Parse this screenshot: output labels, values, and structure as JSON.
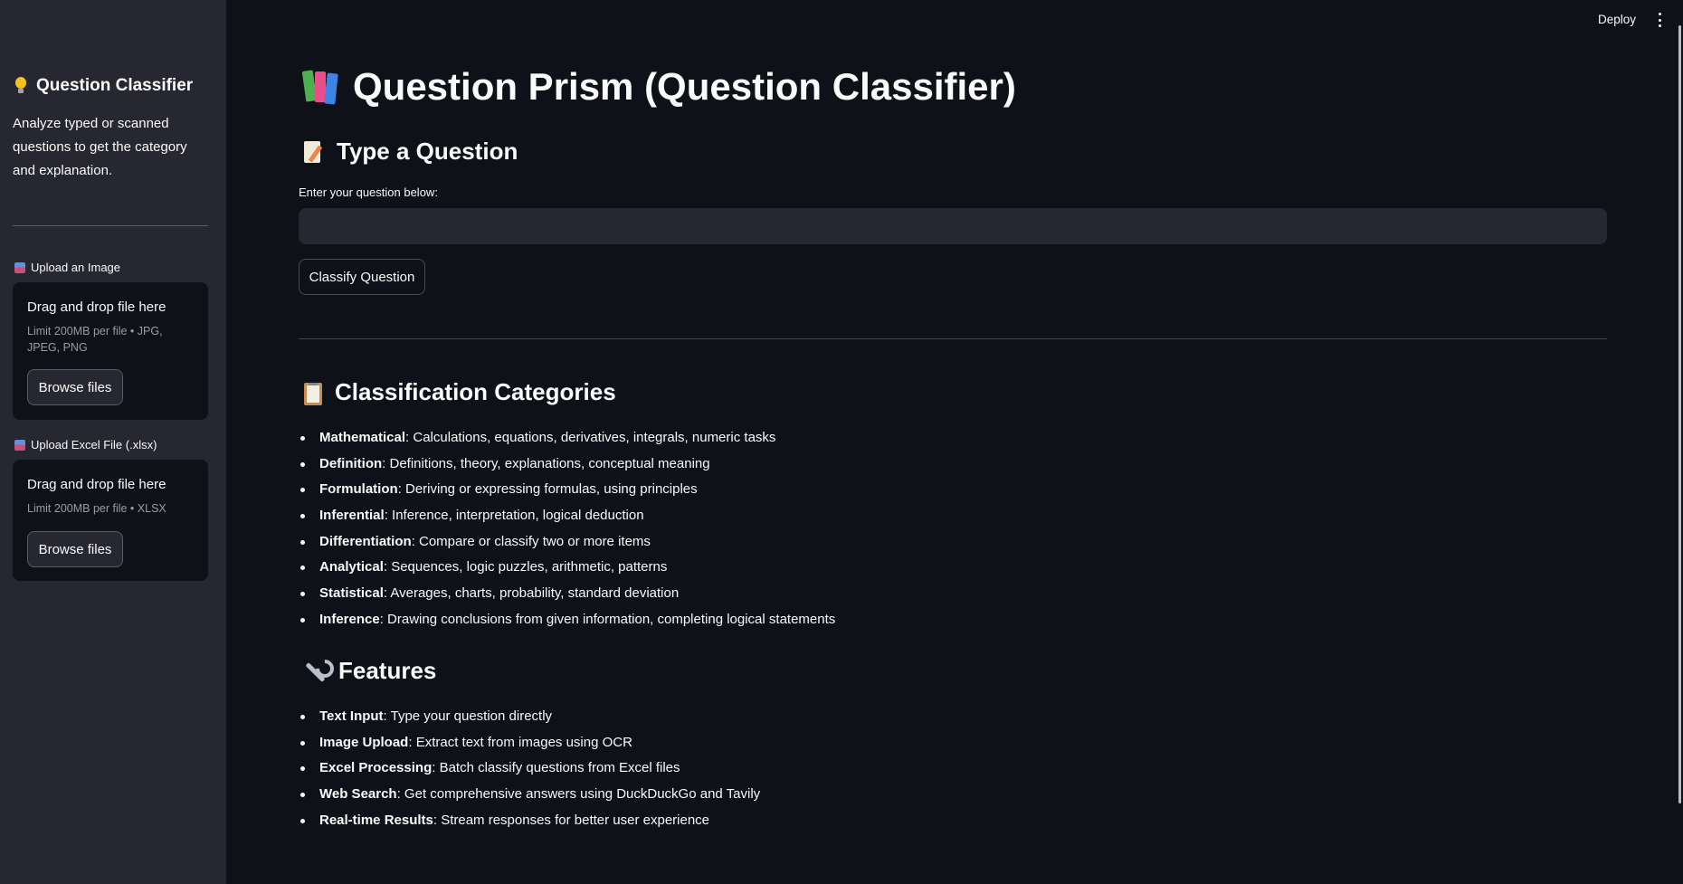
{
  "sidebar": {
    "title": "Question Classifier",
    "description": "Analyze typed or scanned questions to get the category and explanation.",
    "uploaders": [
      {
        "label": "Upload an Image",
        "drop_text": "Drag and drop file here",
        "limit": "Limit 200MB per file • JPG, JPEG, PNG",
        "button": "Browse files"
      },
      {
        "label": "Upload Excel File (.xlsx)",
        "drop_text": "Drag and drop file here",
        "limit": "Limit 200MB per file • XLSX",
        "button": "Browse files"
      }
    ]
  },
  "header": {
    "deploy_label": "Deploy"
  },
  "main": {
    "title": "Question Prism (Question Classifier)",
    "type_section": {
      "heading": "Type a Question",
      "input_label": "Enter your question below:",
      "input_value": "",
      "button": "Classify Question"
    },
    "categories": {
      "heading": "Classification Categories",
      "items": [
        {
          "name": "Mathematical",
          "desc": ": Calculations, equations, derivatives, integrals, numeric tasks"
        },
        {
          "name": "Definition",
          "desc": ": Definitions, theory, explanations, conceptual meaning"
        },
        {
          "name": "Formulation",
          "desc": ": Deriving or expressing formulas, using principles"
        },
        {
          "name": "Inferential",
          "desc": ": Inference, interpretation, logical deduction"
        },
        {
          "name": "Differentiation",
          "desc": ": Compare or classify two or more items"
        },
        {
          "name": "Analytical",
          "desc": ": Sequences, logic puzzles, arithmetic, patterns"
        },
        {
          "name": "Statistical",
          "desc": ": Averages, charts, probability, standard deviation"
        },
        {
          "name": "Inference",
          "desc": ": Drawing conclusions from given information, completing logical statements"
        }
      ]
    },
    "features": {
      "heading": "Features",
      "items": [
        {
          "name": "Text Input",
          "desc": ": Type your question directly"
        },
        {
          "name": "Image Upload",
          "desc": ": Extract text from images using OCR"
        },
        {
          "name": "Excel Processing",
          "desc": ": Batch classify questions from Excel files"
        },
        {
          "name": "Web Search",
          "desc": ": Get comprehensive answers using DuckDuckGo and Tavily"
        },
        {
          "name": "Real-time Results",
          "desc": ": Stream responses for better user experience"
        }
      ]
    }
  },
  "icons": {
    "sidebar_title": "lightbulb-icon",
    "page_title": "books-icon",
    "type_heading": "memo-icon",
    "categories_heading": "clipboard-icon",
    "features_heading": "wrench-icon",
    "uploader": "package-icon"
  },
  "colors": {
    "background": "#0e1117",
    "sidebar": "#262730",
    "text": "#fafafa",
    "muted": "#9a9ca4"
  }
}
